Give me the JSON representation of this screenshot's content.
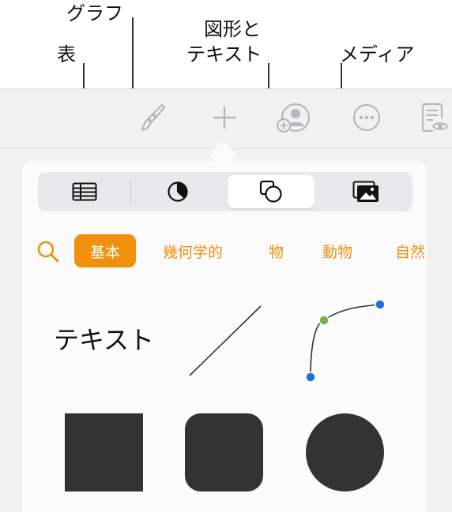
{
  "callouts": {
    "table": "表",
    "chart": "グラフ",
    "shapes_line1": "図形と",
    "shapes_line2": "テキスト",
    "media": "メディア"
  },
  "toolbar": {
    "icons": [
      "paintbrush-icon",
      "plus-icon",
      "collaborate-icon",
      "more-icon",
      "reader-view-icon"
    ]
  },
  "insert_tabs": [
    {
      "icon": "table-icon",
      "selected": false
    },
    {
      "icon": "chart-icon",
      "selected": false
    },
    {
      "icon": "shapes-icon",
      "selected": true
    },
    {
      "icon": "media-icon",
      "selected": false
    }
  ],
  "categories": {
    "items": [
      {
        "label": "基本",
        "selected": true
      },
      {
        "label": "幾何学的",
        "selected": false
      },
      {
        "label": "物",
        "selected": false
      },
      {
        "label": "動物",
        "selected": false
      },
      {
        "label": "自然",
        "selected": false
      }
    ]
  },
  "shapes": {
    "text_label": "テキスト",
    "items": [
      "text",
      "line",
      "curve",
      "square",
      "rounded-square",
      "circle"
    ]
  },
  "colors": {
    "accent": "#f0900d",
    "shape_fill": "#333333",
    "curve_start": "#72b545",
    "curve_handle": "#1d72de"
  }
}
